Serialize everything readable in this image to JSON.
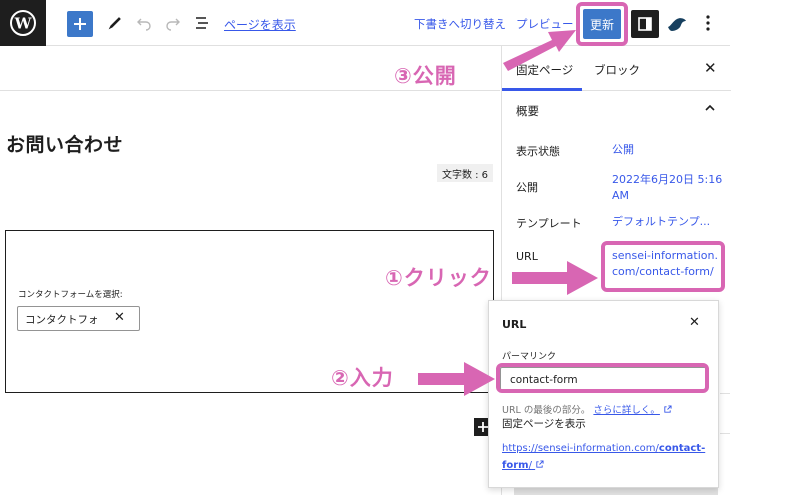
{
  "toolbar": {
    "view_page_link": "ページを表示",
    "save_draft": "下書きへ切り替え",
    "preview": "プレビュー",
    "update": "更新"
  },
  "editor": {
    "page_title": "お問い合わせ",
    "char_count": "文字数 : 6",
    "form_select_label": "コンタクトフォームを選択:",
    "form_token": "コンタクトフォ",
    "token_remove": "✕"
  },
  "sidebar": {
    "tabs": [
      {
        "label": "固定ページ",
        "active": true
      },
      {
        "label": "ブロック",
        "active": false
      }
    ],
    "close": "✕",
    "summary_title": "概要",
    "rows": [
      {
        "label": "表示状態",
        "value": "公開"
      },
      {
        "label": "公開",
        "value": "2022年6月20日 5:16 AM"
      },
      {
        "label": "テンプレート",
        "value": "デフォルトテンプ..."
      },
      {
        "label": "URL",
        "value": "sensei-information.com/contact-form/"
      }
    ]
  },
  "url_popover": {
    "title": "URL",
    "close": "✕",
    "permalink_label": "パーマリンク",
    "permalink_value": "contact-form",
    "help_text": "URL の最後の部分。",
    "learn_more": "さらに詳しく。",
    "view_label": "固定ページを表示",
    "link_base": "https://sensei-information.com/",
    "link_slug": "contact-form",
    "link_tail": "/"
  },
  "annotations": {
    "step_publish": "③公開",
    "step_click": "①クリック",
    "step_input": "②入力"
  },
  "colors": {
    "accent": "#3c78c9",
    "link": "#3858e9",
    "highlight": "#d866b3",
    "dark": "#1e1e1e"
  },
  "icons": [
    "wordpress-icon",
    "plus-icon",
    "pencil-icon",
    "undo-icon",
    "redo-icon",
    "list-view-icon",
    "sidebar-icon",
    "plugin-icon",
    "more-vertical-icon",
    "chevron-up-icon",
    "external-link-icon"
  ]
}
